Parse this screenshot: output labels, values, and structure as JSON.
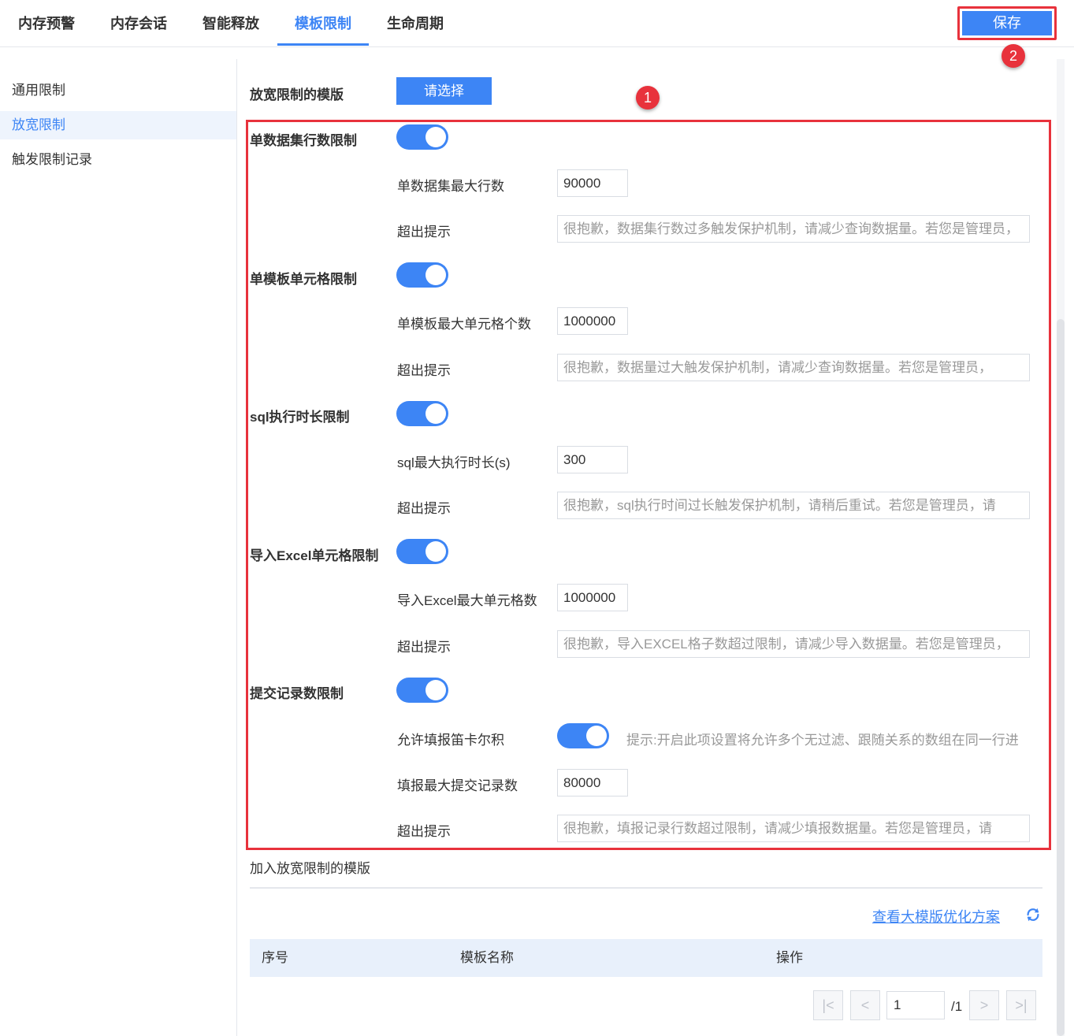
{
  "tabs": [
    {
      "label": "内存预警"
    },
    {
      "label": "内存会话"
    },
    {
      "label": "智能释放"
    },
    {
      "label": "模板限制",
      "active": true
    },
    {
      "label": "生命周期"
    }
  ],
  "save_label": "保存",
  "badges": [
    "1",
    "2"
  ],
  "sidebar": {
    "items": [
      {
        "label": "通用限制"
      },
      {
        "label": "放宽限制",
        "active": true
      },
      {
        "label": "触发限制记录"
      }
    ]
  },
  "relaxed": {
    "label": "放宽限制的模版",
    "choose_label": "请选择"
  },
  "sections": {
    "dataset": {
      "title": "单数据集行数限制",
      "enabled": true,
      "max_label": "单数据集最大行数",
      "max_value": "90000",
      "tip_label": "超出提示",
      "tip_value": "很抱歉，数据集行数过多触发保护机制，请减少查询数据量。若您是管理员，"
    },
    "cells": {
      "title": "单模板单元格限制",
      "enabled": true,
      "max_label": "单模板最大单元格个数",
      "max_value": "1000000",
      "tip_label": "超出提示",
      "tip_value": "很抱歉，数据量过大触发保护机制，请减少查询数据量。若您是管理员，"
    },
    "sql": {
      "title": "sql执行时长限制",
      "enabled": true,
      "max_label": "sql最大执行时长(s)",
      "max_value": "300",
      "tip_label": "超出提示",
      "tip_value": "很抱歉，sql执行时间过长触发保护机制，请稍后重试。若您是管理员，请"
    },
    "excel": {
      "title": "导入Excel单元格限制",
      "enabled": true,
      "max_label": "导入Excel最大单元格数",
      "max_value": "1000000",
      "tip_label": "超出提示",
      "tip_value": "很抱歉，导入EXCEL格子数超过限制，请减少导入数据量。若您是管理员，"
    },
    "submit": {
      "title": "提交记录数限制",
      "enabled": true,
      "cartesian_label": "允许填报笛卡尔积",
      "cartesian_enabled": true,
      "cartesian_hint": "提示:开启此项设置将允许多个无过滤、跟随关系的数组在同一行进",
      "max_label": "填报最大提交记录数",
      "max_value": "80000",
      "tip_label": "超出提示",
      "tip_value": "很抱歉，填报记录行数超过限制，请减少填报数据量。若您是管理员，请"
    }
  },
  "added": {
    "label": "加入放宽限制的模版",
    "link": "查看大模版优化方案",
    "refresh_icon": "refresh-icon"
  },
  "table": {
    "columns": [
      "序号",
      "模板名称",
      "操作"
    ]
  },
  "pagination": {
    "first": "|<",
    "prev": "<",
    "page": "1",
    "total": "/1",
    "next": ">",
    "last": ">|"
  },
  "colors": {
    "accent": "#3d85f5",
    "annotation_red": "#e8323c",
    "table_header_bg": "#e8f0fb",
    "sidebar_active_bg": "#eef4fd"
  }
}
